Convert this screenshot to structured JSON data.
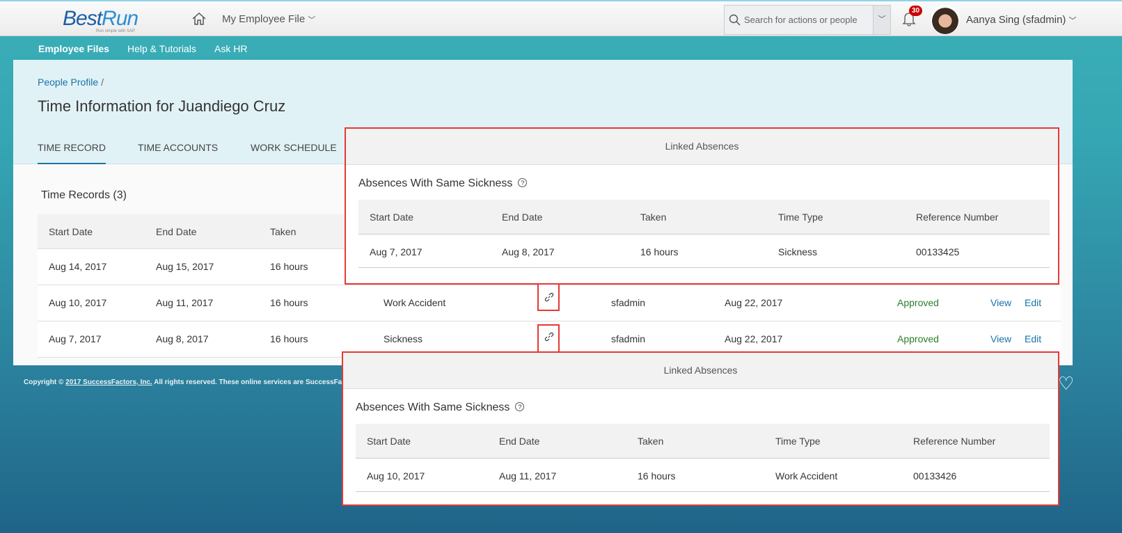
{
  "header": {
    "logo": "BestRun",
    "logo_tagline": "Run simple with SAP",
    "home_icon": "home-icon",
    "module": "My Employee File",
    "search_placeholder": "Search for actions or people",
    "notification_count": "30",
    "user": "Aanya Sing (sfadmin)"
  },
  "nav": [
    "Employee Files",
    "Help & Tutorials",
    "Ask HR"
  ],
  "page": {
    "breadcrumb": "People Profile",
    "breadcrumb_sep": "/",
    "title": "Time Information for Juandiego Cruz",
    "tabs": [
      "TIME RECORD",
      "TIME ACCOUNTS",
      "WORK SCHEDULE"
    ]
  },
  "records": {
    "title": "Time Records (3)",
    "columns": [
      "Start Date",
      "End Date",
      "Taken"
    ],
    "rows": [
      {
        "start": "Aug 14, 2017",
        "end": "Aug 15, 2017",
        "taken": "16 hours"
      },
      {
        "start": "Aug 10, 2017",
        "end": "Aug 11, 2017",
        "taken": "16 hours",
        "type": "Work Accident",
        "by": "sfadmin",
        "date": "Aug 22, 2017",
        "status": "Approved",
        "view": "View",
        "edit": "Edit"
      },
      {
        "start": "Aug 7, 2017",
        "end": "Aug 8, 2017",
        "taken": "16 hours",
        "type": "Sickness",
        "by": "sfadmin",
        "date": "Aug 22, 2017",
        "status": "Approved",
        "view": "View",
        "edit": "Edit"
      }
    ]
  },
  "popovers": [
    {
      "header": "Linked Absences",
      "title": "Absences With Same Sickness",
      "columns": [
        "Start Date",
        "End Date",
        "Taken",
        "Time Type",
        "Reference Number"
      ],
      "row": [
        "Aug 7, 2017",
        "Aug 8, 2017",
        "16 hours",
        "Sickness",
        "00133425"
      ]
    },
    {
      "header": "Linked Absences",
      "title": "Absences With Same Sickness",
      "columns": [
        "Start Date",
        "End Date",
        "Taken",
        "Time Type",
        "Reference Number"
      ],
      "row": [
        "Aug 10, 2017",
        "Aug 11, 2017",
        "16 hours",
        "Work Accident",
        "00133426"
      ]
    }
  ],
  "footer": {
    "prefix": "Copyright ©",
    "link": "2017 SuccessFactors, Inc.",
    "suffix": "All rights reserved. These online services are SuccessFa"
  },
  "colors": {
    "accent": "#1a73a8",
    "approved": "#2b7d2b",
    "highlight": "#e53935"
  }
}
